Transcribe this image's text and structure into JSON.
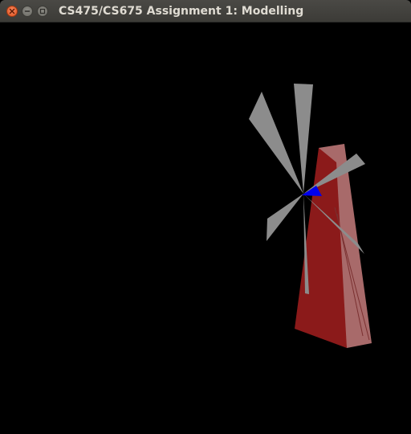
{
  "window": {
    "title": "CS475/CS675 Assignment 1: Modelling",
    "controls": [
      "close-icon",
      "minimize-icon",
      "maximize-icon"
    ]
  },
  "scene": {
    "description_icon": "windmill-model",
    "colors": {
      "background": "#000000",
      "tower_front": "#8b1a1a",
      "tower_side": "#a86a6a",
      "blades": "#8c8c8c",
      "hub": "#0000ee"
    }
  }
}
